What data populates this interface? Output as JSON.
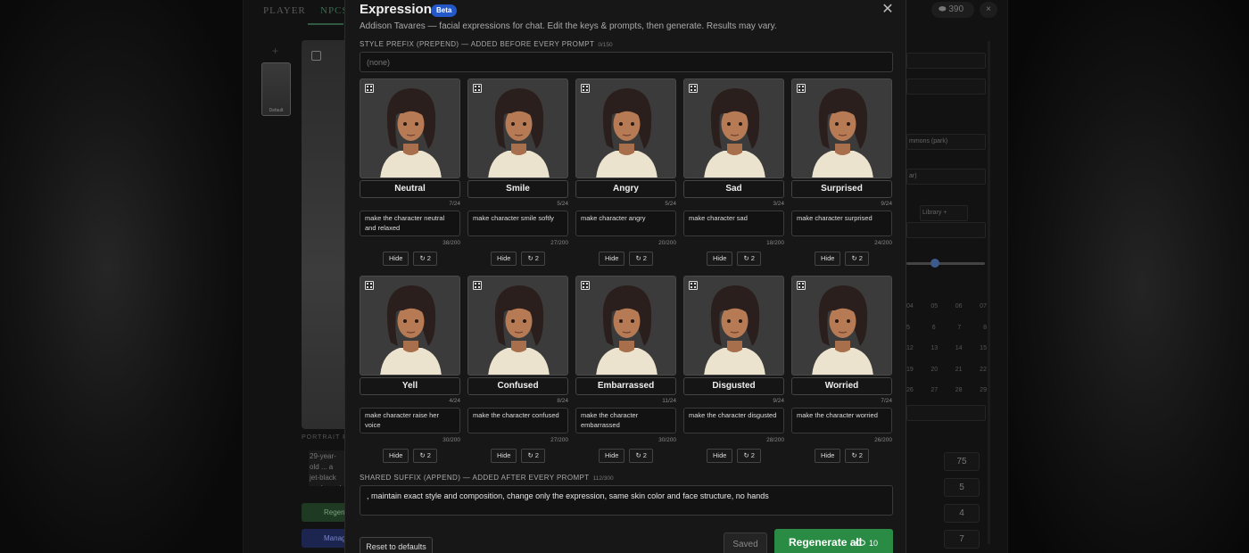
{
  "background_app": {
    "tabs": [
      "PLAYER",
      "NPCS"
    ],
    "thumbnail_label": "Default",
    "portrait_label": "PORTRAIT PR",
    "description_snippet": "29-year-old ... a jet-black ... shaped eye... cream knit ...",
    "green_button": "Regen",
    "blue_button": "Manag",
    "coins": "390",
    "close": "×",
    "fields": [
      "mmons (park)",
      "ar)",
      "Library +"
    ],
    "calendar_header": [
      "04",
      "05",
      "06",
      "07"
    ],
    "calendar_rows": [
      [
        "5",
        "6",
        "7",
        "8"
      ],
      [
        "12",
        "13",
        "14",
        "15"
      ],
      [
        "19",
        "20",
        "21",
        "22"
      ],
      [
        "26",
        "27",
        "28",
        "29"
      ]
    ],
    "numbers": [
      "75",
      "5",
      "4",
      "7"
    ]
  },
  "modal": {
    "title": "Expressions",
    "badge": "Beta",
    "close_label": "✕",
    "subtitle": "Addison Tavares — facial expressions for chat. Edit the keys & prompts, then generate. Results may vary.",
    "prefix": {
      "label": "STYLE PREFIX (PREPEND) — ADDED BEFORE EVERY PROMPT",
      "count": "0/150",
      "placeholder": "(none)",
      "value": ""
    },
    "hide_label": "Hide",
    "regen_label": "↻ 2",
    "expressions": [
      {
        "name": "Neutral",
        "name_count": "7/24",
        "prompt": "make the character neutral and relaxed",
        "prompt_count": "38/200"
      },
      {
        "name": "Smile",
        "name_count": "5/24",
        "prompt": "make character smile softly",
        "prompt_count": "27/200"
      },
      {
        "name": "Angry",
        "name_count": "5/24",
        "prompt": "make character angry",
        "prompt_count": "20/200"
      },
      {
        "name": "Sad",
        "name_count": "3/24",
        "prompt": "make character sad",
        "prompt_count": "18/200"
      },
      {
        "name": "Surprised",
        "name_count": "9/24",
        "prompt": "make character surprised",
        "prompt_count": "24/200"
      },
      {
        "name": "Yell",
        "name_count": "4/24",
        "prompt": "make character raise her voice",
        "prompt_count": "30/200"
      },
      {
        "name": "Confused",
        "name_count": "8/24",
        "prompt": "make the character confused",
        "prompt_count": "27/200"
      },
      {
        "name": "Embarrassed",
        "name_count": "11/24",
        "prompt": "make the character embarrassed",
        "prompt_count": "30/200"
      },
      {
        "name": "Disgusted",
        "name_count": "9/24",
        "prompt": "make the character disgusted",
        "prompt_count": "28/200"
      },
      {
        "name": "Worried",
        "name_count": "7/24",
        "prompt": "make the character worried",
        "prompt_count": "26/200"
      }
    ],
    "suffix": {
      "label": "SHARED SUFFIX (APPEND) — ADDED AFTER EVERY PROMPT",
      "count": "112/300",
      "value": ", maintain exact style and composition, change only the expression, same skin color and face structure, no hands"
    },
    "footer": {
      "reset": "Reset to defaults",
      "saved": "Saved",
      "regenerate": "Regenerate all",
      "cost": "10"
    }
  },
  "colors": {
    "accent_green": "#2a8c44",
    "beta_blue": "#2458c8",
    "modal_bg": "#171717"
  }
}
